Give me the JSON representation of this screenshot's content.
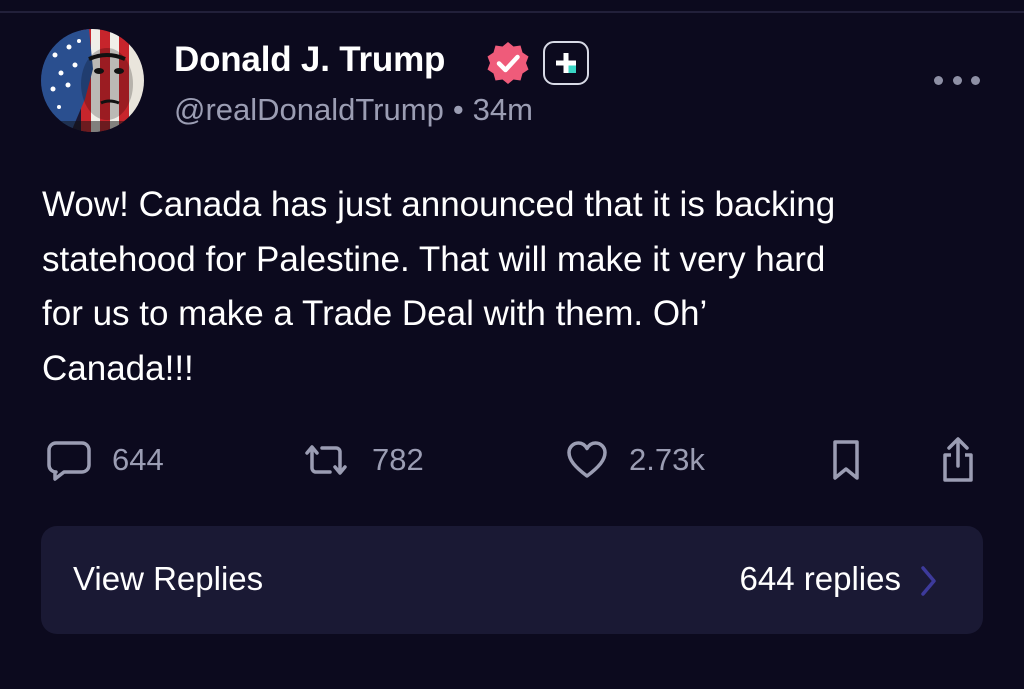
{
  "post": {
    "author_name": "Donald J. Trump",
    "handle": "@realDonaldTrump",
    "separator": "•",
    "time_ago": "34m",
    "body": "Wow! Canada has just announced that it is backing\nstatehood for Palestine. That will make it very hard\nfor us to make a Trade Deal with them. Oh’\nCanada!!!"
  },
  "badges": {
    "verified_icon": "verified-check-badge-icon",
    "verified_color": "#ef5b7a",
    "plus_icon": "plus-square-icon"
  },
  "actions": {
    "reply_count": "644",
    "repost_count": "782",
    "like_count": "2.73k"
  },
  "replies": {
    "label": "View Replies",
    "count_text": "644 replies"
  },
  "colors": {
    "background": "#0c0a1e",
    "card": "#1a1934",
    "muted_text": "#9b9db3",
    "chevron": "#3d3a9b"
  }
}
